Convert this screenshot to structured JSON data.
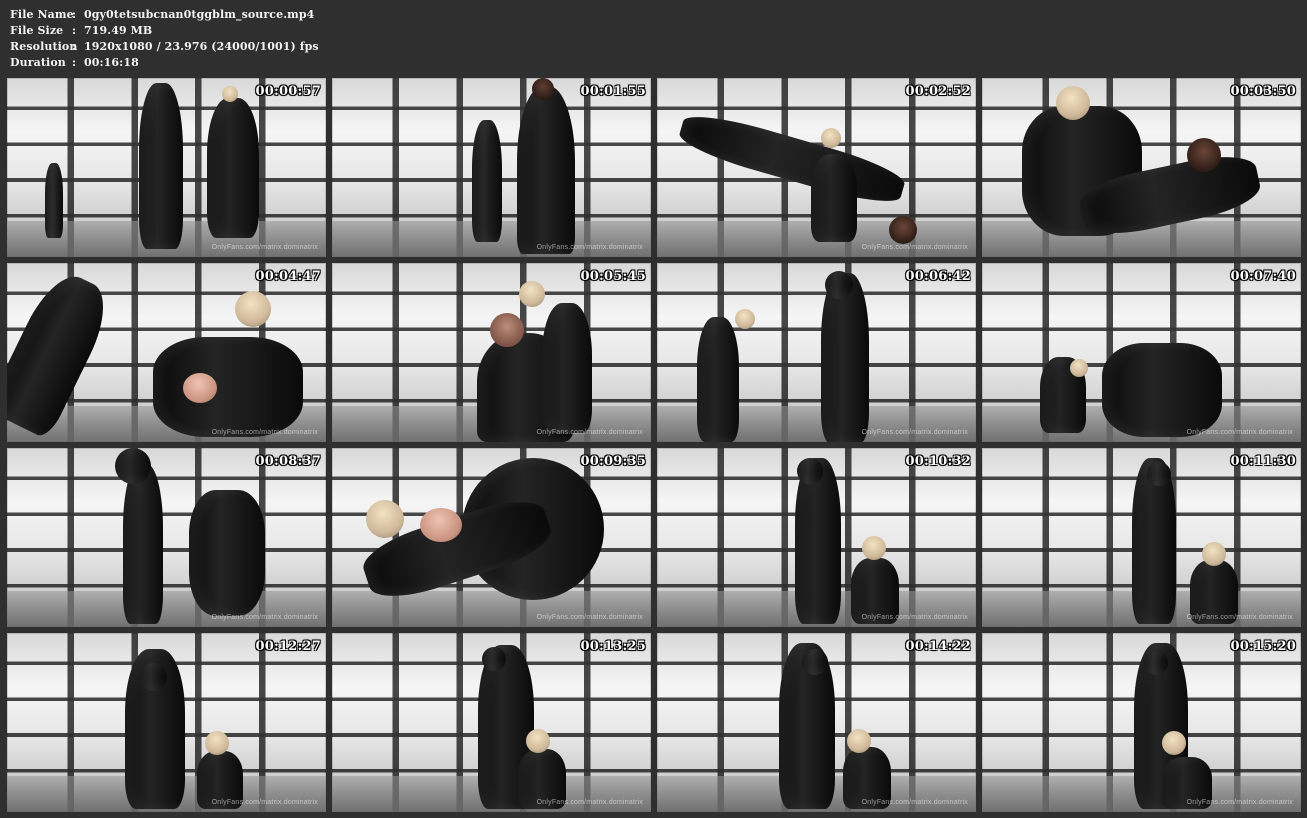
{
  "header": {
    "file_name_label": "File Name",
    "file_name_value": "0gy0tetsubcnan0tggblm_source.mp4",
    "file_size_label": "File Size",
    "file_size_value": "719.49 MB",
    "resolution_label": "Resolution",
    "resolution_value": "1920x1080 / 23.976 (24000/1001) fps",
    "duration_label": "Duration",
    "duration_value": "00:16:18",
    "separator": ":"
  },
  "thumbs": [
    {
      "time": "00:00:57",
      "watermark": "OnlyFans.com/matrix.dominatrix"
    },
    {
      "time": "00:01:55",
      "watermark": "OnlyFans.com/matrix.dominatrix"
    },
    {
      "time": "00:02:52",
      "watermark": "OnlyFans.com/matrix.dominatrix"
    },
    {
      "time": "00:03:50",
      "watermark": ""
    },
    {
      "time": "00:04:47",
      "watermark": "OnlyFans.com/matrix.dominatrix"
    },
    {
      "time": "00:05:45",
      "watermark": "OnlyFans.com/matrix.dominatrix"
    },
    {
      "time": "00:06:42",
      "watermark": "OnlyFans.com/matrix.dominatrix"
    },
    {
      "time": "00:07:40",
      "watermark": "OnlyFans.com/matrix.dominatrix"
    },
    {
      "time": "00:08:37",
      "watermark": "OnlyFans.com/matrix.dominatrix"
    },
    {
      "time": "00:09:35",
      "watermark": "OnlyFans.com/matrix.dominatrix"
    },
    {
      "time": "00:10:32",
      "watermark": "OnlyFans.com/matrix.dominatrix"
    },
    {
      "time": "00:11:30",
      "watermark": "OnlyFans.com/matrix.dominatrix"
    },
    {
      "time": "00:12:27",
      "watermark": "OnlyFans.com/matrix.dominatrix"
    },
    {
      "time": "00:13:25",
      "watermark": "OnlyFans.com/matrix.dominatrix"
    },
    {
      "time": "00:14:22",
      "watermark": "OnlyFans.com/matrix.dominatrix"
    },
    {
      "time": "00:15:20",
      "watermark": "OnlyFans.com/matrix.dominatrix"
    }
  ]
}
